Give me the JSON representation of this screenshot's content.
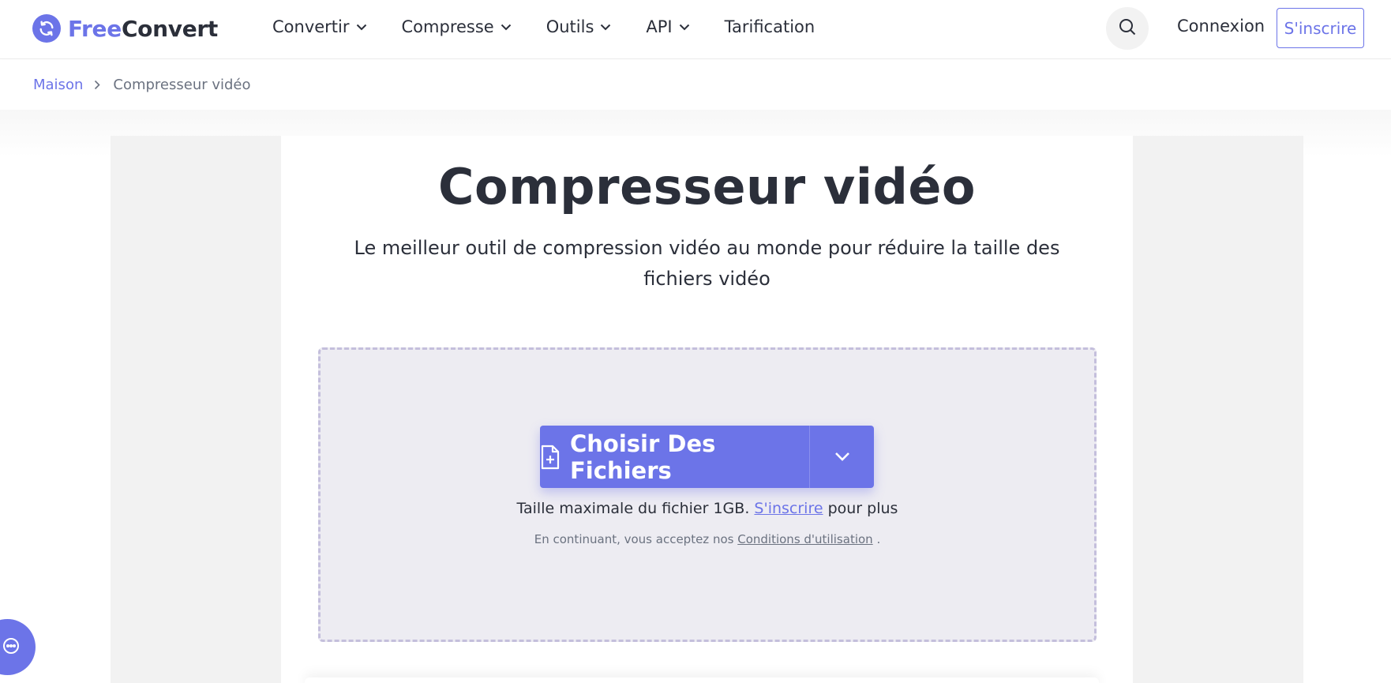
{
  "brand": {
    "name_part1": "Free",
    "name_part2": "Convert",
    "accent": "#6c74e8",
    "text": "#2b2f3a"
  },
  "nav": {
    "items": [
      {
        "label": "Convertir",
        "has_menu": true
      },
      {
        "label": "Compresse",
        "has_menu": true
      },
      {
        "label": "Outils",
        "has_menu": true
      },
      {
        "label": "API",
        "has_menu": true
      },
      {
        "label": "Tarification",
        "has_menu": false
      }
    ],
    "search_icon": "search-icon",
    "login": "Connexion",
    "signup": "S'inscrire"
  },
  "breadcrumb": {
    "home": "Maison",
    "current": "Compresseur vidéo"
  },
  "hero": {
    "title": "Compresseur vidéo",
    "subtitle": "Le meilleur outil de compression vidéo au monde pour réduire la taille des fichiers vidéo"
  },
  "upload": {
    "choose_label": "Choisir Des Fichiers",
    "limit_prefix": "Taille maximale du fichier 1GB.",
    "limit_link": "S'inscrire",
    "limit_suffix": "pour plus",
    "terms_prefix": "En continuant, vous acceptez nos",
    "terms_link": "Conditions d'utilisation",
    "terms_suffix": "."
  },
  "chat": {
    "icon": "chat-icon"
  }
}
